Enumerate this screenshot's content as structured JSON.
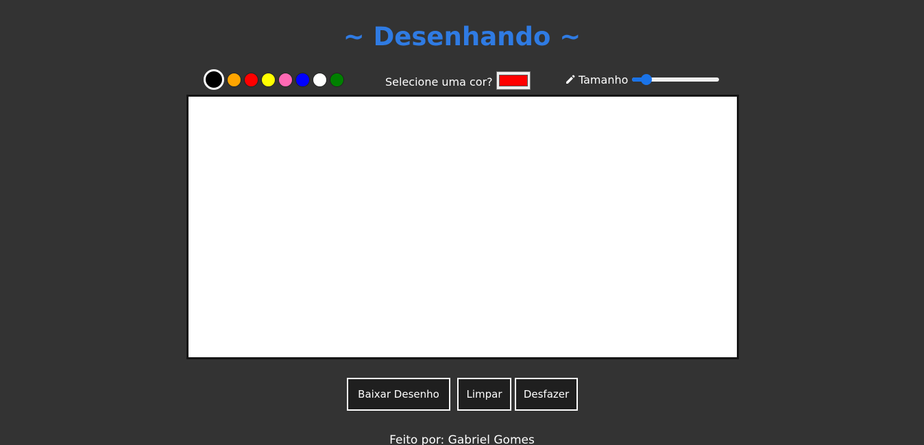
{
  "header": {
    "title": "~ Desenhando ~"
  },
  "palette": {
    "swatches": [
      {
        "color": "#000000",
        "selected": true
      },
      {
        "color": "#ffa500"
      },
      {
        "color": "#ff0000"
      },
      {
        "color": "#ffff00"
      },
      {
        "color": "#ff69b4"
      },
      {
        "color": "#0000ff"
      },
      {
        "color": "#ffffff"
      },
      {
        "color": "#008000"
      }
    ]
  },
  "color_picker": {
    "label": "Selecione uma cor?",
    "value": "#ff0000"
  },
  "size": {
    "icon": "pencil-icon",
    "label": "Tamanho",
    "value_fraction": 0.12
  },
  "buttons": {
    "download_label": "Baixar Desenho",
    "clear_label": "Limpar",
    "undo_label": "Desfazer"
  },
  "footer": {
    "credit": "Feito por: Gabriel Gomes"
  },
  "colors": {
    "background": "#333333",
    "title": "#2f7be3",
    "accent": "#1a73e8"
  }
}
